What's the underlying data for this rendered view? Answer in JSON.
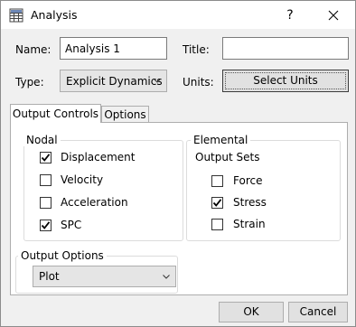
{
  "window": {
    "title": "Analysis",
    "help_label": "?"
  },
  "form": {
    "name_label": "Name:",
    "name_value": "Analysis 1",
    "title_label": "Title:",
    "title_value": "",
    "type_label": "Type:",
    "type_value": "Explicit Dynamics",
    "units_label": "Units:",
    "select_units_label": "Select Units"
  },
  "tabs": [
    {
      "label": "Output Controls",
      "active": true
    },
    {
      "label": "Options",
      "active": false
    }
  ],
  "nodal": {
    "title": "Nodal",
    "items": [
      {
        "label": "Displacement",
        "checked": true
      },
      {
        "label": "Velocity",
        "checked": false
      },
      {
        "label": "Acceleration",
        "checked": false
      },
      {
        "label": "SPC",
        "checked": true
      }
    ]
  },
  "elemental": {
    "title": "Elemental",
    "subtitle": "Output Sets",
    "items": [
      {
        "label": "Force",
        "checked": false
      },
      {
        "label": "Stress",
        "checked": true
      },
      {
        "label": "Strain",
        "checked": false
      }
    ]
  },
  "output_options": {
    "title": "Output Options",
    "selected": "Plot"
  },
  "footer": {
    "ok_label": "OK",
    "cancel_label": "Cancel"
  }
}
